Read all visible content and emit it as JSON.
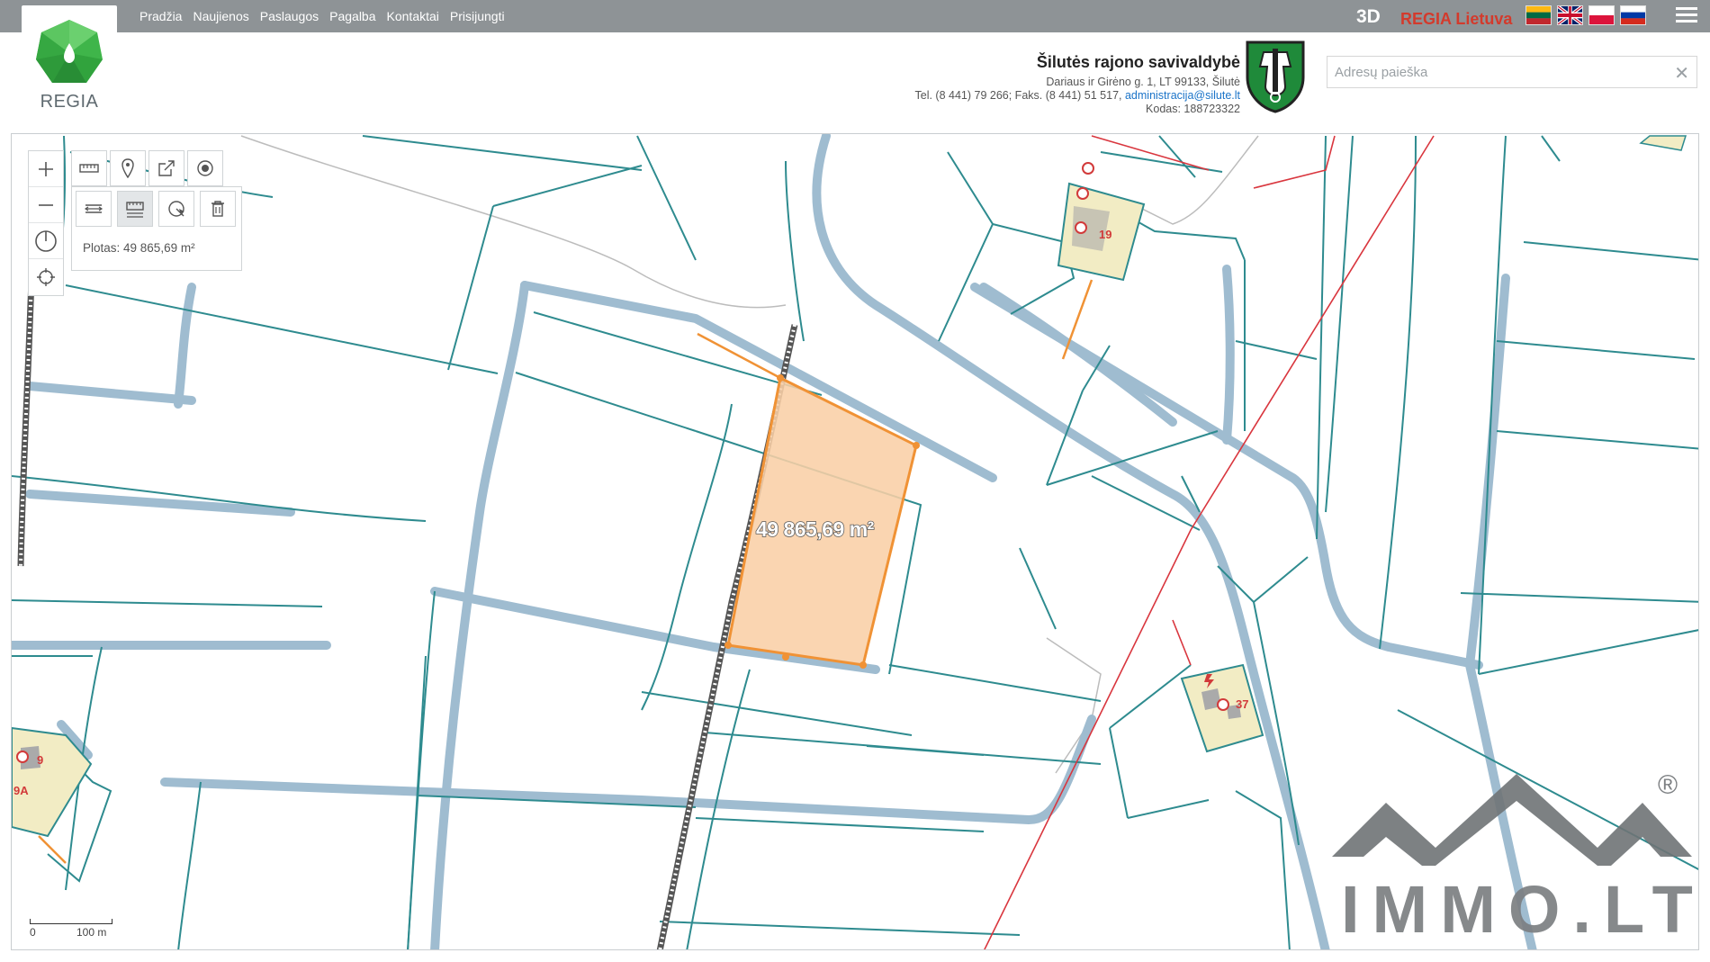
{
  "header": {
    "logo_text": "REGIA",
    "nav": [
      "Pradžia",
      "Naujienos",
      "Paslaugos",
      "Pagalba",
      "Kontaktai",
      "Prisijungti"
    ],
    "btn_3d": "3D",
    "regia_lietuva": "REGIA Lietuva",
    "flags": [
      "lt-flag-icon",
      "gb-flag-icon",
      "pl-flag-icon",
      "ru-flag-icon"
    ]
  },
  "municipality": {
    "name": "Šilutės rajono savivaldybė",
    "address": "Dariaus ir Girėno g. 1, LT 99133, Šilutė",
    "phone": "Tel. (8 441) 79 266; Faks. (8 441) 51 517,",
    "email": "administracija@silute.lt",
    "code": "Kodas: 188723322"
  },
  "search": {
    "placeholder": "Adresų paieška",
    "value": ""
  },
  "map": {
    "measure_result": "Plotas: 49 865,69 m²",
    "area_label": "49 865,69 m²",
    "plot_numbers": [
      "19",
      "37",
      "9",
      "9A"
    ],
    "scale": {
      "start": "0",
      "end": "100 m"
    },
    "watermark": {
      "text": "IMMO.LT",
      "registered": "®"
    }
  },
  "colors": {
    "topbar": "#8e9396",
    "parcel_line": "#2e8b8f",
    "road": "#9fbcd0",
    "highlight_fill": "#f9cfa6",
    "highlight_stroke": "#f09235",
    "power_line": "#d9363e",
    "building": "#f2ecc4"
  }
}
